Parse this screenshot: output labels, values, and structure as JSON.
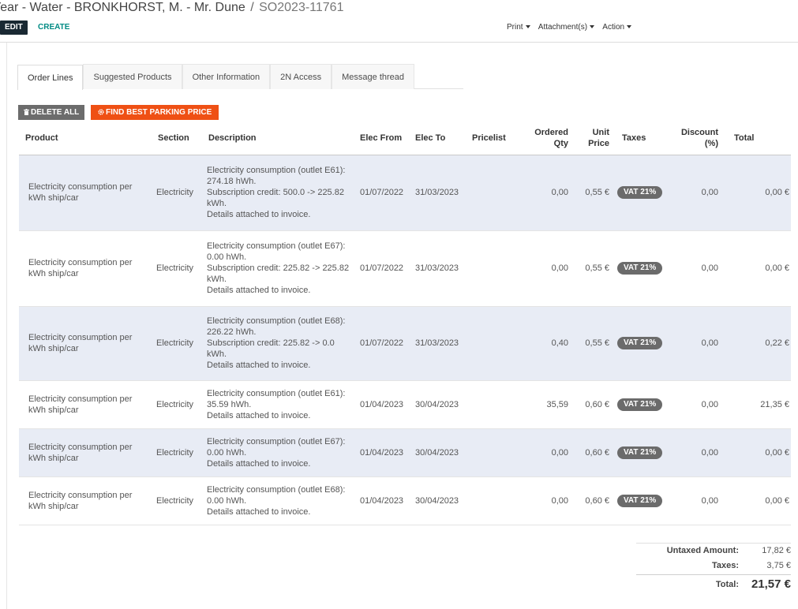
{
  "header": {
    "breadcrumb_parent": "Year - Water - BRONKHORST, M. - Mr. Dune",
    "breadcrumb_sep": "/",
    "breadcrumb_current": "SO2023-11761",
    "edit_label": "EDIT",
    "create_label": "CREATE",
    "print_label": "Print",
    "attachments_label": "Attachment(s)",
    "action_label": "Action"
  },
  "tabs": [
    {
      "label": "Order Lines",
      "active": true
    },
    {
      "label": "Suggested Products"
    },
    {
      "label": "Other Information"
    },
    {
      "label": "2N Access"
    },
    {
      "label": "Message thread"
    }
  ],
  "buttons": {
    "delete_all": "DELETE ALL",
    "find_parking": "FIND BEST PARKING PRICE"
  },
  "icons": {
    "delete": "trash-icon",
    "parking": "gear-icon",
    "dropdown": "caret-down-icon"
  },
  "columns": {
    "product": "Product",
    "section": "Section",
    "description": "Description",
    "elec_from": "Elec From",
    "elec_to": "Elec To",
    "pricelist": "Pricelist",
    "ordered_qty": "Ordered Qty",
    "unit_price": "Unit Price",
    "taxes": "Taxes",
    "discount": "Discount (%)",
    "total": "Total"
  },
  "lines": [
    {
      "product": "Electricity consumption per kWh ship/car",
      "section": "Electricity",
      "description": [
        "Electricity consumption (outlet E61): 274.18 hWh.",
        "Subscription credit: 500.0 -> 225.82 kWh.",
        "Details attached to invoice."
      ],
      "elec_from": "01/07/2022",
      "elec_to": "31/03/2023",
      "pricelist": "",
      "qty": "0,00",
      "price": "0,55 €",
      "tax": "VAT 21%",
      "discount": "0,00",
      "total": "0,00 €"
    },
    {
      "product": "Electricity consumption per kWh ship/car",
      "section": "Electricity",
      "description": [
        "Electricity consumption (outlet E67): 0.00 hWh.",
        "Subscription credit: 225.82 -> 225.82 kWh.",
        "Details attached to invoice."
      ],
      "elec_from": "01/07/2022",
      "elec_to": "31/03/2023",
      "pricelist": "",
      "qty": "0,00",
      "price": "0,55 €",
      "tax": "VAT 21%",
      "discount": "0,00",
      "total": "0,00 €"
    },
    {
      "product": "Electricity consumption per kWh ship/car",
      "section": "Electricity",
      "description": [
        "Electricity consumption (outlet E68): 226.22 hWh.",
        "Subscription credit: 225.82 -> 0.0 kWh.",
        "Details attached to invoice."
      ],
      "elec_from": "01/07/2022",
      "elec_to": "31/03/2023",
      "pricelist": "",
      "qty": "0,40",
      "price": "0,55 €",
      "tax": "VAT 21%",
      "discount": "0,00",
      "total": "0,22 €"
    },
    {
      "product": "Electricity consumption per kWh ship/car",
      "section": "Electricity",
      "description": [
        "Electricity consumption (outlet E61): 35.59 hWh.",
        "Details attached to invoice."
      ],
      "elec_from": "01/04/2023",
      "elec_to": "30/04/2023",
      "pricelist": "",
      "qty": "35,59",
      "price": "0,60 €",
      "tax": "VAT 21%",
      "discount": "0,00",
      "total": "21,35 €"
    },
    {
      "product": "Electricity consumption per kWh ship/car",
      "section": "Electricity",
      "description": [
        "Electricity consumption (outlet E67): 0.00 hWh.",
        "Details attached to invoice."
      ],
      "elec_from": "01/04/2023",
      "elec_to": "30/04/2023",
      "pricelist": "",
      "qty": "0,00",
      "price": "0,60 €",
      "tax": "VAT 21%",
      "discount": "0,00",
      "total": "0,00 €"
    },
    {
      "product": "Electricity consumption per kWh ship/car",
      "section": "Electricity",
      "description": [
        "Electricity consumption (outlet E68): 0.00 hWh.",
        "Details attached to invoice."
      ],
      "elec_from": "01/04/2023",
      "elec_to": "30/04/2023",
      "pricelist": "",
      "qty": "0,00",
      "price": "0,60 €",
      "tax": "VAT 21%",
      "discount": "0,00",
      "total": "0,00 €"
    }
  ],
  "totals": {
    "untaxed_label": "Untaxed Amount:",
    "untaxed_value": "17,82 €",
    "taxes_label": "Taxes:",
    "taxes_value": "3,75 €",
    "total_label": "Total:",
    "total_value": "21,57 €"
  },
  "colors": {
    "accent_orange": "#ef5014",
    "edit_dark": "#1a2933",
    "create_teal": "#018b84",
    "row_highlight": "#e8ecf5",
    "badge_gray": "#6b6b6b"
  }
}
